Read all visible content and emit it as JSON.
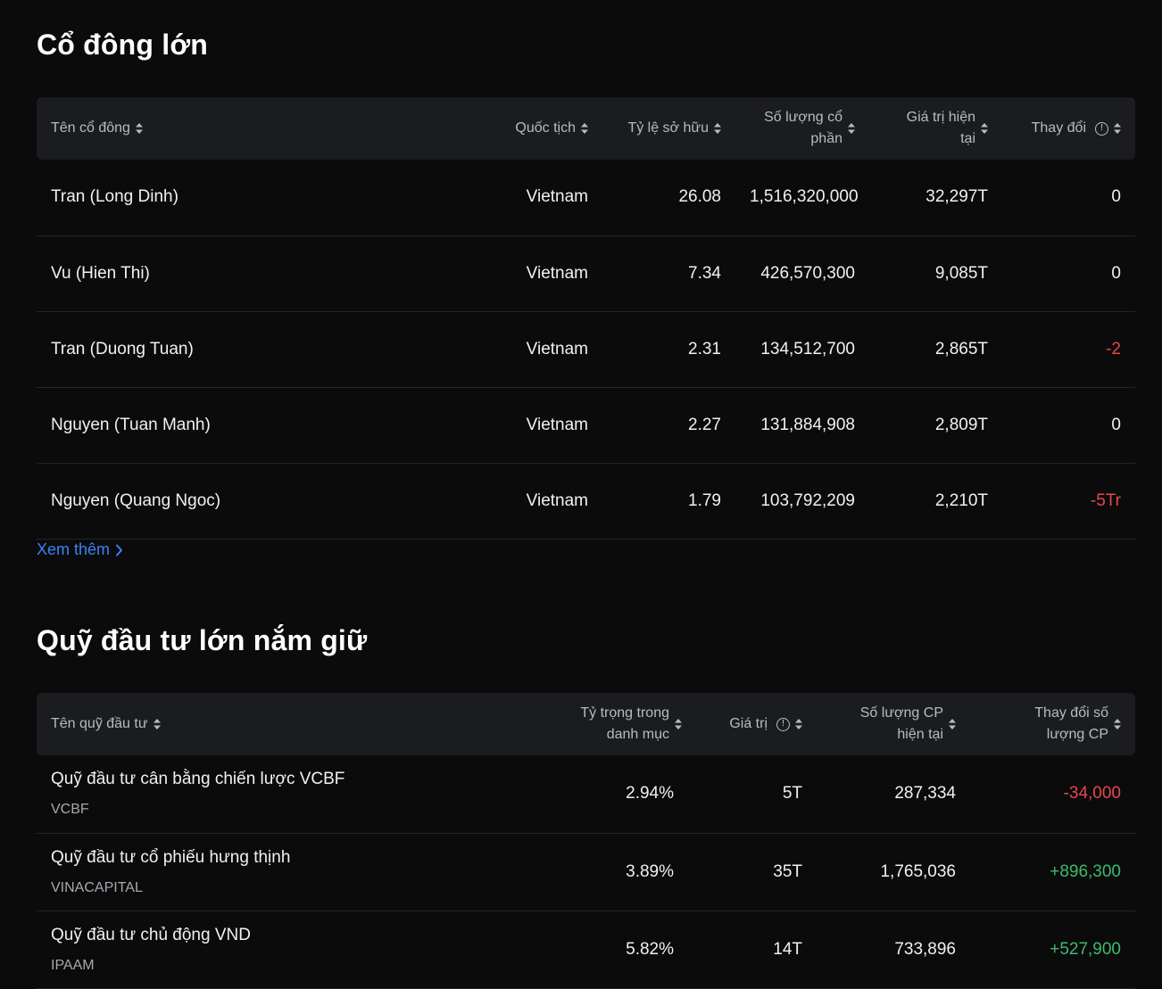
{
  "shareholders": {
    "title": "Cổ đông lớn",
    "columns": [
      "Tên cổ đông",
      "Quốc tịch",
      "Tỷ lệ sở hữu",
      "Số lượng cổ phần",
      "Giá trị hiện tại",
      "Thay đổi"
    ],
    "rows": [
      {
        "name": "Tran (Long Dinh)",
        "nationality": "Vietnam",
        "ratio": "26.08",
        "shares": "1,516,320,000",
        "value": "32,297T",
        "change": "0",
        "change_type": "neutral"
      },
      {
        "name": "Vu (Hien Thi)",
        "nationality": "Vietnam",
        "ratio": "7.34",
        "shares": "426,570,300",
        "value": "9,085T",
        "change": "0",
        "change_type": "neutral"
      },
      {
        "name": "Tran (Duong Tuan)",
        "nationality": "Vietnam",
        "ratio": "2.31",
        "shares": "134,512,700",
        "value": "2,865T",
        "change": "-2",
        "change_type": "negative"
      },
      {
        "name": "Nguyen (Tuan Manh)",
        "nationality": "Vietnam",
        "ratio": "2.27",
        "shares": "131,884,908",
        "value": "2,809T",
        "change": "0",
        "change_type": "neutral"
      },
      {
        "name": "Nguyen (Quang Ngoc)",
        "nationality": "Vietnam",
        "ratio": "1.79",
        "shares": "103,792,209",
        "value": "2,210T",
        "change": "-5Tr",
        "change_type": "negative"
      }
    ],
    "more_label": "Xem thêm"
  },
  "funds": {
    "title": "Quỹ đầu tư lớn nắm giữ",
    "columns": [
      "Tên quỹ đầu tư",
      "Tỷ trọng trong danh mục",
      "Giá trị",
      "Số lượng CP hiện tại",
      "Thay đổi số lượng CP"
    ],
    "rows": [
      {
        "name": "Quỹ đầu tư cân bằng chiến lược VCBF",
        "code": "VCBF",
        "weight": "2.94%",
        "value": "5T",
        "shares": "287,334",
        "change": "-34,000",
        "change_type": "negative"
      },
      {
        "name": "Quỹ đầu tư cổ phiếu hưng thịnh",
        "code": "VINACAPITAL",
        "weight": "3.89%",
        "value": "35T",
        "shares": "1,765,036",
        "change": "+896,300",
        "change_type": "positive"
      },
      {
        "name": "Quỹ đầu tư chủ động VND",
        "code": "IPAAM",
        "weight": "5.82%",
        "value": "14T",
        "shares": "733,896",
        "change": "+527,900",
        "change_type": "positive"
      }
    ]
  },
  "colors": {
    "background": "#0b0b0c",
    "header": "#1b1c1f",
    "link": "#3b82f6",
    "negative": "#e5484d",
    "positive": "#3dbb6d"
  }
}
